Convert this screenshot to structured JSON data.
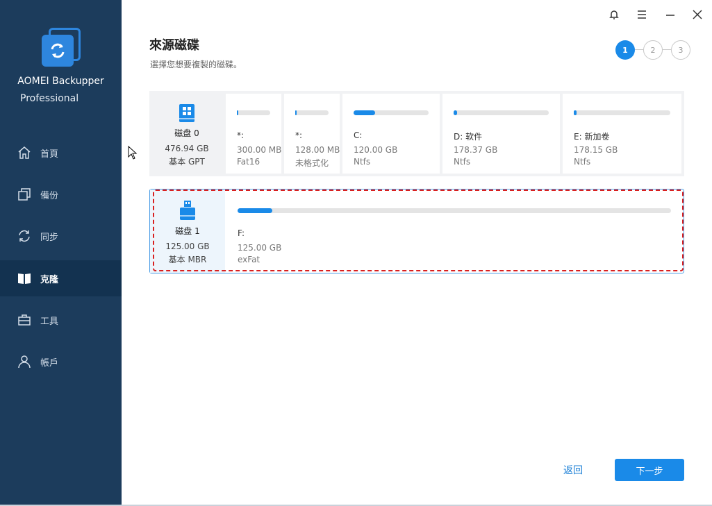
{
  "app": {
    "name": "AOMEI Backupper",
    "edition": "Professional"
  },
  "sidebar": {
    "items": [
      {
        "label": "首頁",
        "icon": "home-icon",
        "active": false
      },
      {
        "label": "備份",
        "icon": "backup-icon",
        "active": false
      },
      {
        "label": "同步",
        "icon": "sync-icon",
        "active": false
      },
      {
        "label": "克隆",
        "icon": "clone-icon",
        "active": true
      },
      {
        "label": "工具",
        "icon": "tools-icon",
        "active": false
      },
      {
        "label": "帳戶",
        "icon": "account-icon",
        "active": false
      }
    ]
  },
  "titlebar": {
    "icons": [
      "bell-icon",
      "menu-icon",
      "minimize-icon",
      "close-icon"
    ]
  },
  "page": {
    "title": "來源磁碟",
    "subtitle": "選擇您想要複製的磁碟。"
  },
  "stepper": {
    "steps": [
      "1",
      "2",
      "3"
    ],
    "current": 1
  },
  "disks": [
    {
      "label": "磁盘 0",
      "size": "476.94 GB",
      "type": "基本 GPT",
      "icon": "windows-disk-icon",
      "selected": false,
      "partitions": [
        {
          "name": "*:",
          "size": "300.00 MB",
          "fs": "Fat16",
          "used_fraction": 0.05
        },
        {
          "name": "*:",
          "size": "128.00 MB",
          "fs": "未格式化",
          "used_fraction": 0.05
        },
        {
          "name": "C:",
          "size": "120.00 GB",
          "fs": "Ntfs",
          "used_fraction": 0.29
        },
        {
          "name": "D: 软件",
          "size": "178.37 GB",
          "fs": "Ntfs",
          "used_fraction": 0.04
        },
        {
          "name": "E: 新加卷",
          "size": "178.15 GB",
          "fs": "Ntfs",
          "used_fraction": 0.03
        }
      ]
    },
    {
      "label": "磁盘 1",
      "size": "125.00 GB",
      "type": "基本 MBR",
      "icon": "usb-disk-icon",
      "selected": true,
      "partitions": [
        {
          "name": "F:",
          "size": "125.00 GB",
          "fs": "exFat",
          "used_fraction": 0.08
        }
      ]
    }
  ],
  "buttons": {
    "back": "返回",
    "next": "下一步"
  },
  "colors": {
    "sidebar": "#1c3c5c",
    "accent": "#1a8ae8",
    "highlight": "#d91f1f"
  }
}
